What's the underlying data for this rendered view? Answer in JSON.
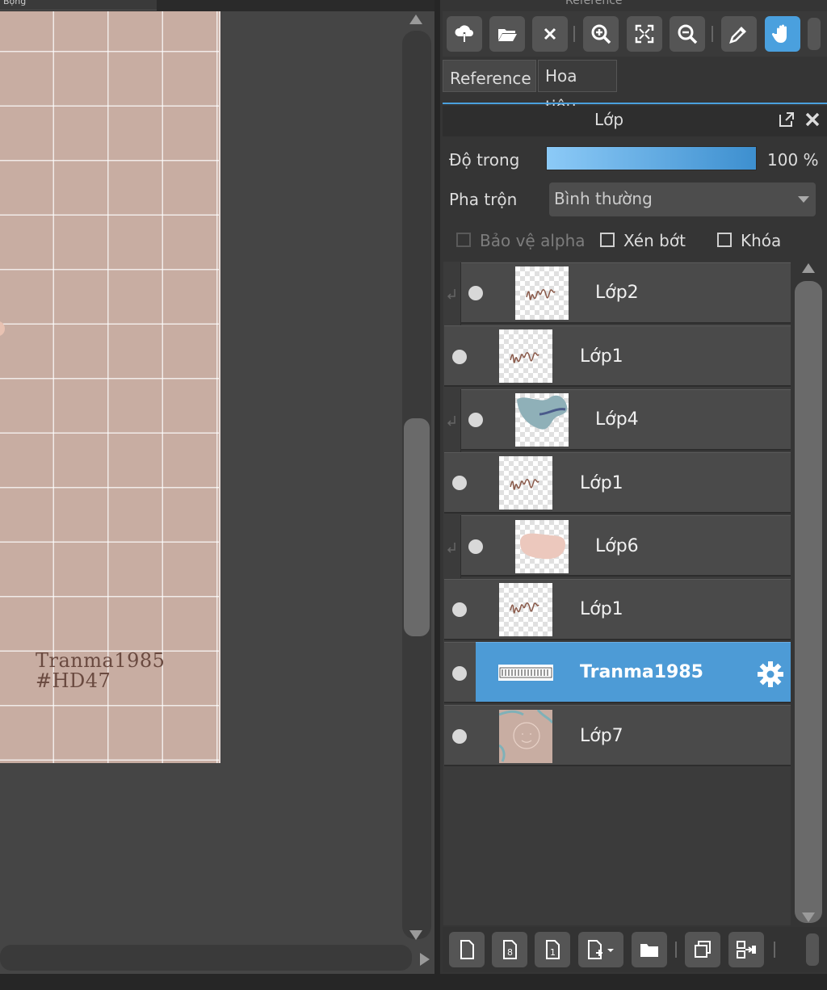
{
  "top_tab_fragment": "Bộng",
  "reference_title": "Reference",
  "canvas": {
    "watermark_line1": "Tranma1985",
    "watermark_line2": "#HD47",
    "paper_color": "#c8ada2"
  },
  "toolbar": {
    "icons": [
      "cloud-upload-icon",
      "open-folder-icon",
      "close-icon",
      "zoom-in-icon",
      "fit-screen-icon",
      "zoom-out-icon",
      "eyedropper-icon",
      "hand-icon"
    ],
    "active": "hand-icon"
  },
  "tabs": [
    {
      "label": "Reference"
    },
    {
      "label": "Hoa tiêu"
    }
  ],
  "layer_panel": {
    "title": "Lớp",
    "opacity_label": "Độ trong",
    "opacity_value": "100 %",
    "opacity": 1.0,
    "blend_label": "Pha trộn",
    "blend_value": "Bình thường",
    "protect_alpha": "Bảo vệ alpha",
    "clipping": "Xén bớt",
    "lock": "Khóa",
    "accent": "#4d9bd6"
  },
  "layers": [
    {
      "name": "Lớp2",
      "clipped": true,
      "thumb": "sketch"
    },
    {
      "name": "Lớp1",
      "clipped": false,
      "thumb": "sketch"
    },
    {
      "name": "Lớp4",
      "clipped": true,
      "thumb": "blue-shape"
    },
    {
      "name": "Lớp1",
      "clipped": false,
      "thumb": "sketch"
    },
    {
      "name": "Lớp6",
      "clipped": true,
      "thumb": "pink-shape"
    },
    {
      "name": "Lớp1",
      "clipped": false,
      "thumb": "sketch"
    },
    {
      "name": "Tranma1985",
      "clipped": false,
      "thumb": "text",
      "selected": true
    },
    {
      "name": "Lớp7",
      "clipped": false,
      "thumb": "background"
    }
  ],
  "bottom_toolbar": {
    "icons": [
      "new-layer-icon",
      "new-8bit-layer-icon",
      "new-1bit-layer-icon",
      "add-layer-menu-icon",
      "new-folder-icon",
      "duplicate-layer-icon",
      "merge-down-icon"
    ]
  }
}
